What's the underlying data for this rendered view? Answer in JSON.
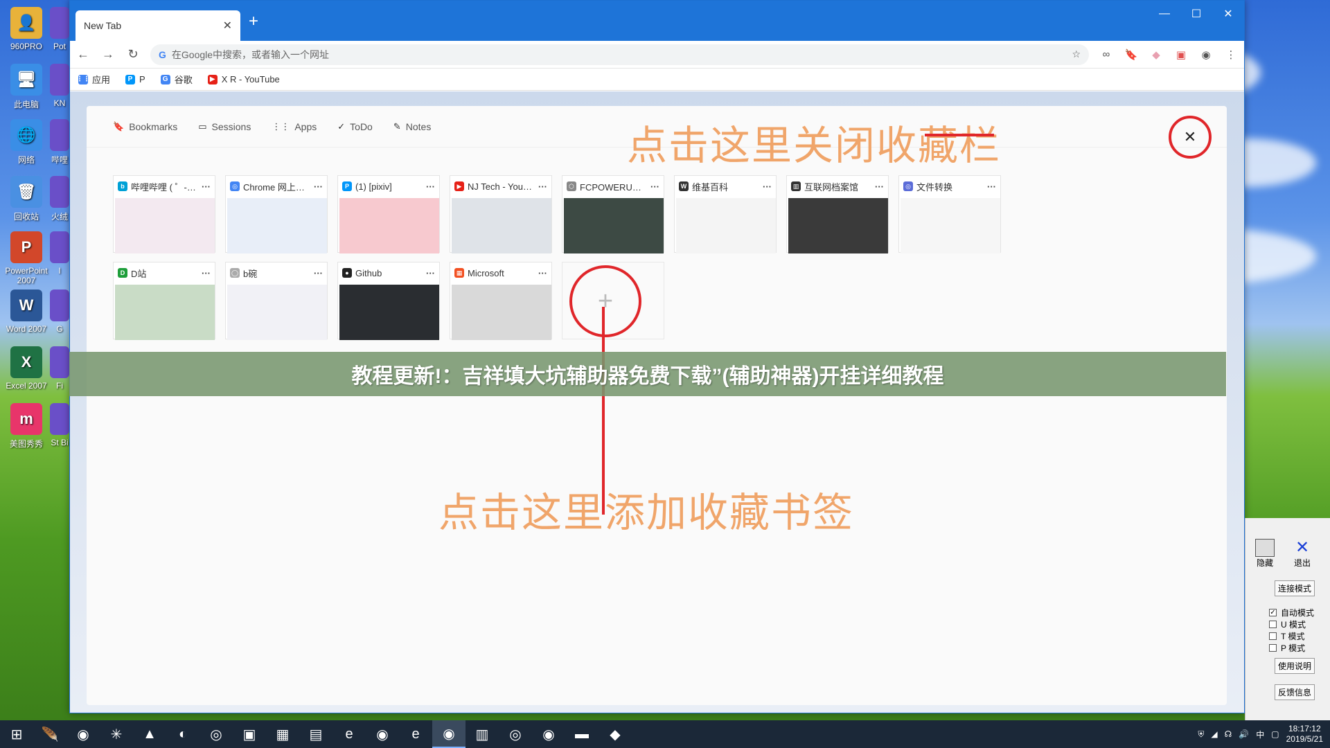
{
  "desktop": {
    "icons": [
      {
        "label": "960PRO",
        "color": "#e8b23a",
        "glyph": "👤"
      },
      {
        "label": "此电脑",
        "color": "#3a8ee6",
        "glyph": "🖥"
      },
      {
        "label": "网络",
        "color": "#3a8ee6",
        "glyph": "🌐"
      },
      {
        "label": "回收站",
        "color": "#4a90e2",
        "glyph": "🗑"
      },
      {
        "label": "PowerPoint 2007",
        "color": "#d2472a",
        "glyph": "P"
      },
      {
        "label": "Word 2007",
        "color": "#2b5797",
        "glyph": "W"
      },
      {
        "label": "Excel 2007",
        "color": "#1f7244",
        "glyph": "X"
      },
      {
        "label": "美图秀秀",
        "color": "#e8356a",
        "glyph": "m"
      }
    ],
    "partial_labels": [
      "Pot",
      "KN",
      "哔哩",
      "火绒",
      "I",
      "G",
      "Fi",
      "St Bi"
    ]
  },
  "browser": {
    "tab_title": "New Tab",
    "tab_close": "✕",
    "new_tab": "+",
    "window_controls": [
      "—",
      "☐",
      "✕"
    ],
    "omnibox_placeholder": "在Google中搜索，或者输入一个网址",
    "bookmarks_bar": [
      {
        "label": "应用",
        "color": "#4285f4",
        "glyph": "⋮⋮"
      },
      {
        "label": "P",
        "color": "#0096fa",
        "glyph": "P"
      },
      {
        "label": "谷歌",
        "color": "#4285f4",
        "glyph": "G"
      },
      {
        "label": "X R - YouTube",
        "color": "#e62117",
        "glyph": "▶"
      }
    ]
  },
  "panel": {
    "nav": [
      {
        "label": "Bookmarks",
        "icon": "bookmark-icon",
        "glyph": "🔖"
      },
      {
        "label": "Sessions",
        "icon": "sessions-icon",
        "glyph": "▭"
      },
      {
        "label": "Apps",
        "icon": "apps-icon",
        "glyph": "⋮⋮"
      },
      {
        "label": "ToDo",
        "icon": "todo-icon",
        "glyph": "✓"
      },
      {
        "label": "Notes",
        "icon": "notes-icon",
        "glyph": "✎"
      }
    ],
    "close_glyph": "✕",
    "more_glyph": "···",
    "add_glyph": "+",
    "tiles": [
      {
        "title": "哔哩哔哩 ( ゜- ゜)つロ 干...",
        "color": "#00a1d6",
        "glyph": "b",
        "thumb": "#f3e9f0"
      },
      {
        "title": "Chrome 网上应用店 - ...",
        "color": "#4285f4",
        "glyph": "◎",
        "thumb": "#e8eef8"
      },
      {
        "title": "(1) [pixiv]",
        "color": "#0096fa",
        "glyph": "P",
        "thumb": "#f7c9cf"
      },
      {
        "title": "NJ Tech - YouTube",
        "color": "#e62117",
        "glyph": "▶",
        "thumb": "#dfe3e8"
      },
      {
        "title": "FCPOWERUP – 极电...",
        "color": "#888888",
        "glyph": "⬡",
        "thumb": "#3d4a44"
      },
      {
        "title": "维基百科",
        "color": "#333333",
        "glyph": "W",
        "thumb": "#f4f4f4"
      },
      {
        "title": "互联网档案馆",
        "color": "#333333",
        "glyph": "▥",
        "thumb": "#3a3a3a"
      },
      {
        "title": "文件转换",
        "color": "#5b6cd8",
        "glyph": "◎",
        "thumb": "#f6f6f6"
      },
      {
        "title": "D站",
        "color": "#1e9e3a",
        "glyph": "D",
        "thumb": "#c9dcc6"
      },
      {
        "title": "b碗",
        "color": "#aaaaaa",
        "glyph": "◯",
        "thumb": "#f1f1f6"
      },
      {
        "title": "Github",
        "color": "#222222",
        "glyph": "●",
        "thumb": "#2a2d31"
      },
      {
        "title": "Microsoft",
        "color": "#f25022",
        "glyph": "▦",
        "thumb": "#d9d9d9"
      }
    ]
  },
  "annotations": {
    "close_hint": "点击这里关闭收藏栏",
    "add_hint": "点击这里添加收藏书签"
  },
  "banner": {
    "text": "教程更新!：吉祥填大坑辅助器免费下载”(辅助神器)开挂详细教程"
  },
  "helper_app": {
    "hide": "隐藏",
    "exit": "退出",
    "connect_mode": "连接模式",
    "modes": [
      {
        "label": "自动模式",
        "checked": "✓"
      },
      {
        "label": "U 模式",
        "checked": ""
      },
      {
        "label": "T 模式",
        "checked": ""
      },
      {
        "label": "P 模式",
        "checked": ""
      }
    ],
    "usage": "使用说明",
    "feedback": "反馈信息"
  },
  "taskbar": {
    "time": "18:17:12",
    "date": "2019/5/21",
    "ime": "中",
    "apps": [
      "🪶",
      "◉",
      "✳",
      "▲",
      "◐",
      "◎",
      "▣",
      "▦",
      "▤",
      "e",
      "◉",
      "e",
      "◉",
      "▥",
      "◎",
      "◉",
      "▬",
      "◆"
    ]
  }
}
